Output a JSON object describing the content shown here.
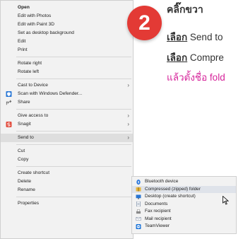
{
  "context_menu": {
    "items": [
      {
        "label": "Open",
        "bold": true
      },
      {
        "label": "Edit with Photos"
      },
      {
        "label": "Edit with Paint 3D"
      },
      {
        "label": "Set as desktop background"
      },
      {
        "label": "Edit"
      },
      {
        "label": "Print"
      },
      {
        "label": "Rotate right"
      },
      {
        "label": "Rotate left"
      },
      {
        "label": "Cast to Device",
        "arrow": true
      },
      {
        "label": "Scan with Windows Defender...",
        "icon": "defender-shield-icon"
      },
      {
        "label": "Share",
        "icon": "share-icon"
      },
      {
        "label": "Give access to",
        "arrow": true
      },
      {
        "label": "Snagit",
        "icon": "snagit-icon",
        "arrow": true
      },
      {
        "label": "Send to",
        "arrow": true,
        "highlighted": true
      },
      {
        "label": "Cut"
      },
      {
        "label": "Copy"
      },
      {
        "label": "Create shortcut"
      },
      {
        "label": "Delete"
      },
      {
        "label": "Rename"
      },
      {
        "label": "Properties"
      }
    ]
  },
  "send_to_submenu": {
    "items": [
      {
        "label": "Bluetooth device",
        "icon": "bluetooth-icon"
      },
      {
        "label": "Compressed (zipped) folder",
        "icon": "zip-folder-icon",
        "highlighted": true
      },
      {
        "label": "Desktop (create shortcut)",
        "icon": "desktop-icon"
      },
      {
        "label": "Documents",
        "icon": "documents-icon"
      },
      {
        "label": "Fax recipient",
        "icon": "fax-icon"
      },
      {
        "label": "Mail recipient",
        "icon": "mail-icon"
      },
      {
        "label": "TeamViewer",
        "icon": "teamviewer-icon"
      }
    ]
  },
  "annotation": {
    "step_number": "2",
    "line1": "คลิ๊กขวา",
    "line2_prefix": "เลือก",
    "line2_text": " Send to",
    "line3_prefix": "เลือก",
    "line3_text": " Compre",
    "line4": "แล้วตั้งชื่อ fold"
  },
  "colors": {
    "badge": "#e33a35",
    "highlight_text": "#d6239a"
  }
}
